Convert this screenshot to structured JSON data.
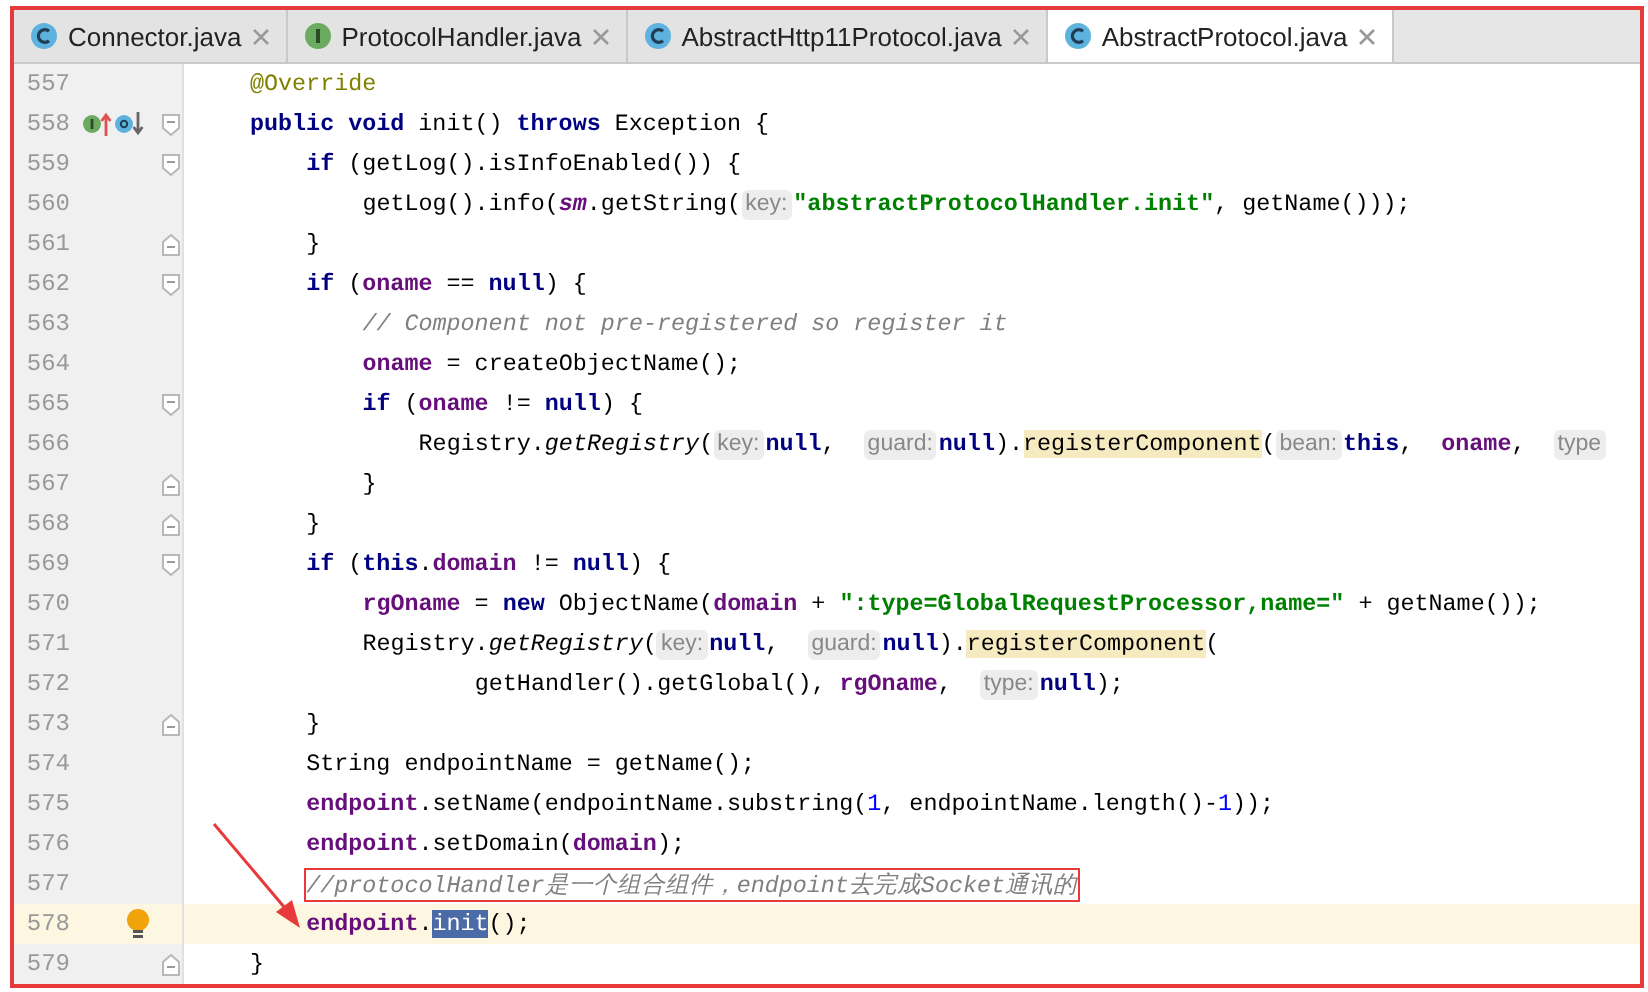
{
  "tabs": [
    {
      "label": "Connector.java",
      "kind": "class",
      "selected": false
    },
    {
      "label": "ProtocolHandler.java",
      "kind": "interface",
      "selected": false
    },
    {
      "label": "AbstractHttp11Protocol.java",
      "kind": "class",
      "selected": false
    },
    {
      "label": "AbstractProtocol.java",
      "kind": "class",
      "selected": true
    }
  ],
  "lines": [
    {
      "n": "557",
      "kind": "code",
      "current": false,
      "tokens": [
        {
          "kind": "ann",
          "t": "@Override"
        }
      ]
    },
    {
      "n": "558",
      "kind": "code",
      "current": false,
      "gutter_icons": [
        {
          "kind": "implementing"
        },
        {
          "kind": "overriding"
        }
      ],
      "tokens": [
        {
          "kind": "kw",
          "t": "public void"
        },
        {
          "kind": "t",
          "t": " init() "
        },
        {
          "kind": "kw",
          "t": "throws"
        },
        {
          "kind": "t",
          "t": " Exception {"
        }
      ],
      "children": [
        {
          "n": "559",
          "kind": "code",
          "current": false,
          "tokens": [
            {
              "kind": "kw",
              "t": "if"
            },
            {
              "kind": "t",
              "t": " (getLog().isInfoEnabled()) {"
            }
          ],
          "children": [
            {
              "n": "560",
              "kind": "code",
              "current": false,
              "tokens": [
                {
                  "kind": "t",
                  "t": "getLog().info("
                },
                {
                  "kind": "sfld",
                  "t": "sm"
                },
                {
                  "kind": "t",
                  "t": ".getString("
                },
                {
                  "kind": "hint",
                  "t": "key:"
                },
                {
                  "kind": "str",
                  "t": "\"abstractProtocolHandler.init\""
                },
                {
                  "kind": "t",
                  "t": ", getName()));"
                }
              ]
            }
          ]
        },
        {
          "n": "561",
          "kind": "close",
          "current": false,
          "tokens": [
            {
              "kind": "t",
              "t": "}"
            }
          ]
        },
        {
          "n": "562",
          "kind": "code",
          "current": false,
          "tokens": [
            {
              "kind": "kw",
              "t": "if"
            },
            {
              "kind": "t",
              "t": " ("
            },
            {
              "kind": "fld",
              "t": "oname"
            },
            {
              "kind": "t",
              "t": " == "
            },
            {
              "kind": "kw",
              "t": "null"
            },
            {
              "kind": "t",
              "t": ") {"
            }
          ],
          "children": [
            {
              "n": "563",
              "kind": "code",
              "current": false,
              "tokens": [
                {
                  "kind": "cmt",
                  "t": "// Component not pre-registered so register it"
                }
              ]
            },
            {
              "n": "564",
              "kind": "code",
              "current": false,
              "tokens": [
                {
                  "kind": "fld",
                  "t": "oname"
                },
                {
                  "kind": "t",
                  "t": " = createObjectName();"
                }
              ]
            },
            {
              "n": "565",
              "kind": "code",
              "current": false,
              "tokens": [
                {
                  "kind": "kw",
                  "t": "if"
                },
                {
                  "kind": "t",
                  "t": " ("
                },
                {
                  "kind": "fld",
                  "t": "oname"
                },
                {
                  "kind": "t",
                  "t": " != "
                },
                {
                  "kind": "kw",
                  "t": "null"
                },
                {
                  "kind": "t",
                  "t": ") {"
                }
              ],
              "children": [
                {
                  "n": "566",
                  "kind": "code",
                  "current": false,
                  "tokens": [
                    {
                      "kind": "t",
                      "t": "Registry."
                    },
                    {
                      "kind": "ital",
                      "t": "getRegistry"
                    },
                    {
                      "kind": "t",
                      "t": "("
                    },
                    {
                      "kind": "hint",
                      "t": "key:"
                    },
                    {
                      "kind": "kw",
                      "t": "null"
                    },
                    {
                      "kind": "t",
                      "t": ",  "
                    },
                    {
                      "kind": "hint",
                      "t": "guard:"
                    },
                    {
                      "kind": "kw",
                      "t": "null"
                    },
                    {
                      "kind": "t",
                      "t": ")."
                    },
                    {
                      "kind": "hl",
                      "t": "registerComponent"
                    },
                    {
                      "kind": "t",
                      "t": "("
                    },
                    {
                      "kind": "hint",
                      "t": "bean:"
                    },
                    {
                      "kind": "kw",
                      "t": "this"
                    },
                    {
                      "kind": "t",
                      "t": ",  "
                    },
                    {
                      "kind": "fld",
                      "t": "oname"
                    },
                    {
                      "kind": "t",
                      "t": ",  "
                    },
                    {
                      "kind": "hint",
                      "t": "type"
                    }
                  ]
                }
              ]
            },
            {
              "n": "567",
              "kind": "close",
              "current": false,
              "tokens": [
                {
                  "kind": "t",
                  "t": "}"
                }
              ]
            }
          ]
        },
        {
          "n": "568",
          "kind": "close",
          "current": false,
          "tokens": [
            {
              "kind": "t",
              "t": "}"
            }
          ]
        },
        {
          "n": "569",
          "kind": "code",
          "current": false,
          "tokens": [
            {
              "kind": "kw",
              "t": "if"
            },
            {
              "kind": "t",
              "t": " ("
            },
            {
              "kind": "kw",
              "t": "this"
            },
            {
              "kind": "t",
              "t": "."
            },
            {
              "kind": "fld",
              "t": "domain"
            },
            {
              "kind": "t",
              "t": " != "
            },
            {
              "kind": "kw",
              "t": "null"
            },
            {
              "kind": "t",
              "t": ") {"
            }
          ],
          "children": [
            {
              "n": "570",
              "kind": "code",
              "current": false,
              "tokens": [
                {
                  "kind": "fld",
                  "t": "rgOname"
                },
                {
                  "kind": "t",
                  "t": " = "
                },
                {
                  "kind": "kw",
                  "t": "new"
                },
                {
                  "kind": "t",
                  "t": " ObjectName("
                },
                {
                  "kind": "fld",
                  "t": "domain"
                },
                {
                  "kind": "t",
                  "t": " + "
                },
                {
                  "kind": "str",
                  "t": "\":type=GlobalRequestProcessor,name=\""
                },
                {
                  "kind": "t",
                  "t": " + getName());"
                }
              ]
            },
            {
              "n": "571",
              "kind": "code",
              "current": false,
              "tokens": [
                {
                  "kind": "t",
                  "t": "Registry."
                },
                {
                  "kind": "ital",
                  "t": "getRegistry"
                },
                {
                  "kind": "t",
                  "t": "("
                },
                {
                  "kind": "hint",
                  "t": "key:"
                },
                {
                  "kind": "kw",
                  "t": "null"
                },
                {
                  "kind": "t",
                  "t": ",  "
                },
                {
                  "kind": "hint",
                  "t": "guard:"
                },
                {
                  "kind": "kw",
                  "t": "null"
                },
                {
                  "kind": "t",
                  "t": ")."
                },
                {
                  "kind": "hl",
                  "t": "registerComponent"
                },
                {
                  "kind": "t",
                  "t": "("
                }
              ]
            },
            {
              "n": "572",
              "kind": "continuation",
              "current": false,
              "tokens": [
                {
                  "kind": "t",
                  "t": "getHandler().getGlobal(), "
                },
                {
                  "kind": "fld",
                  "t": "rgOname"
                },
                {
                  "kind": "t",
                  "t": ",  "
                },
                {
                  "kind": "hint",
                  "t": "type:"
                },
                {
                  "kind": "kw",
                  "t": "null"
                },
                {
                  "kind": "t",
                  "t": ");"
                }
              ]
            }
          ]
        },
        {
          "n": "573",
          "kind": "close",
          "current": false,
          "tokens": [
            {
              "kind": "t",
              "t": "}"
            }
          ]
        },
        {
          "n": "574",
          "kind": "code",
          "current": false,
          "tokens": [
            {
              "kind": "t",
              "t": "String endpointName = getName();"
            }
          ]
        },
        {
          "n": "575",
          "kind": "code",
          "current": false,
          "tokens": [
            {
              "kind": "fld",
              "t": "endpoint"
            },
            {
              "kind": "t",
              "t": ".setName(endpointName.substring("
            },
            {
              "kind": "num",
              "t": "1"
            },
            {
              "kind": "t",
              "t": ", endpointName.length()-"
            },
            {
              "kind": "num",
              "t": "1"
            },
            {
              "kind": "t",
              "t": "));"
            }
          ]
        },
        {
          "n": "576",
          "kind": "code",
          "current": false,
          "tokens": [
            {
              "kind": "fld",
              "t": "endpoint"
            },
            {
              "kind": "t",
              "t": ".setDomain("
            },
            {
              "kind": "fld",
              "t": "domain"
            },
            {
              "kind": "t",
              "t": ");"
            }
          ]
        },
        {
          "n": "577",
          "kind": "code",
          "current": false,
          "tokens": [
            {
              "kind": "cmt",
              "t": "//protocolHandler是一个组合组件，endpoint去完成Socket通讯的",
              "boxed": true
            }
          ]
        },
        {
          "n": "578",
          "kind": "code",
          "current": true,
          "gutter_icons": [
            {
              "kind": "bulb"
            }
          ],
          "tokens": [
            {
              "kind": "fld",
              "t": "endpoint"
            },
            {
              "kind": "t",
              "t": "."
            },
            {
              "kind": "sel",
              "t": "init"
            },
            {
              "kind": "t",
              "t": "();"
            }
          ]
        }
      ]
    },
    {
      "n": "579",
      "kind": "close",
      "current": false,
      "tokens": [
        {
          "kind": "t",
          "t": "}"
        }
      ]
    }
  ]
}
